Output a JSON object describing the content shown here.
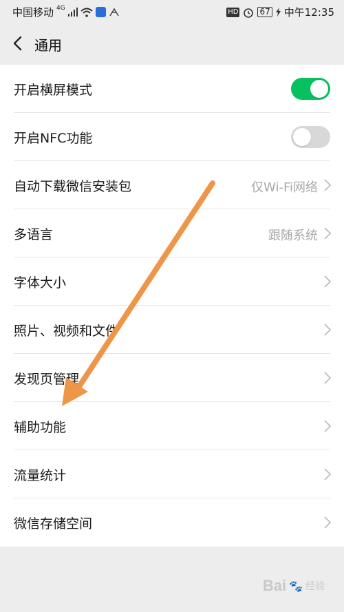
{
  "status_bar": {
    "carrier": "中国移动",
    "network": "4G",
    "time": "中午12:35",
    "battery": "67",
    "hd": "HD"
  },
  "nav": {
    "title": "通用"
  },
  "settings": {
    "landscape": {
      "label": "开启横屏模式",
      "on": true
    },
    "nfc": {
      "label": "开启NFC功能",
      "on": false
    },
    "auto_download": {
      "label": "自动下载微信安装包",
      "value": "仅Wi-Fi网络"
    },
    "language": {
      "label": "多语言",
      "value": "跟随系统"
    },
    "font_size": {
      "label": "字体大小"
    },
    "media": {
      "label": "照片、视频和文件"
    },
    "discover": {
      "label": "发现页管理"
    },
    "accessibility": {
      "label": "辅助功能"
    },
    "data_usage": {
      "label": "流量统计"
    },
    "storage": {
      "label": "微信存储空间"
    }
  },
  "colors": {
    "toggle_on": "#07c160",
    "toggle_off": "#d8d8d8",
    "annotation_arrow": "#ef9548"
  },
  "watermark": {
    "logo": "Bai",
    "text": "经验"
  }
}
